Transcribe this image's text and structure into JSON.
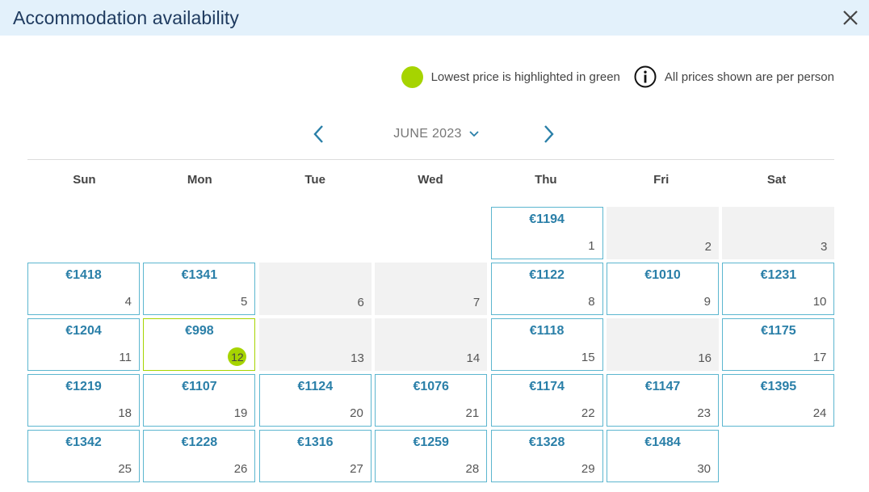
{
  "dialog": {
    "title": "Accommodation availability"
  },
  "legend": {
    "lowest_label": "Lowest price is highlighted in green",
    "info_label": "All prices shown are per person",
    "lowest_color": "#a6d400"
  },
  "calendar": {
    "month_label": "JUNE 2023",
    "weekdays": [
      "Sun",
      "Mon",
      "Tue",
      "Wed",
      "Thu",
      "Fri",
      "Sat"
    ],
    "days": [
      {
        "day": "1",
        "price": "€1194"
      },
      {
        "day": "2",
        "price": null
      },
      {
        "day": "3",
        "price": null
      },
      {
        "day": "4",
        "price": "€1418"
      },
      {
        "day": "5",
        "price": "€1341"
      },
      {
        "day": "6",
        "price": null
      },
      {
        "day": "7",
        "price": null
      },
      {
        "day": "8",
        "price": "€1122"
      },
      {
        "day": "9",
        "price": "€1010"
      },
      {
        "day": "10",
        "price": "€1231"
      },
      {
        "day": "11",
        "price": "€1204"
      },
      {
        "day": "12",
        "price": "€998",
        "lowest": true
      },
      {
        "day": "13",
        "price": null
      },
      {
        "day": "14",
        "price": null
      },
      {
        "day": "15",
        "price": "€1118"
      },
      {
        "day": "16",
        "price": null
      },
      {
        "day": "17",
        "price": "€1175"
      },
      {
        "day": "18",
        "price": "€1219"
      },
      {
        "day": "19",
        "price": "€1107"
      },
      {
        "day": "20",
        "price": "€1124"
      },
      {
        "day": "21",
        "price": "€1076"
      },
      {
        "day": "22",
        "price": "€1174"
      },
      {
        "day": "23",
        "price": "€1147"
      },
      {
        "day": "24",
        "price": "€1395"
      },
      {
        "day": "25",
        "price": "€1342"
      },
      {
        "day": "26",
        "price": "€1228"
      },
      {
        "day": "27",
        "price": "€1316"
      },
      {
        "day": "28",
        "price": "€1259"
      },
      {
        "day": "29",
        "price": "€1328"
      },
      {
        "day": "30",
        "price": "€1484"
      }
    ]
  }
}
